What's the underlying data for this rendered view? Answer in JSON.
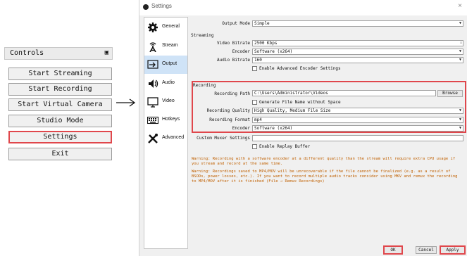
{
  "controls": {
    "title": "Controls",
    "buttons": [
      "Start Streaming",
      "Start Recording",
      "Start Virtual Camera",
      "Studio Mode",
      "Settings",
      "Exit"
    ],
    "highlighted": "Settings"
  },
  "window": {
    "title": "Settings",
    "close_label": "×"
  },
  "sidebar": {
    "items": [
      {
        "label": "General",
        "icon": "gear-icon"
      },
      {
        "label": "Stream",
        "icon": "stream-antenna-icon"
      },
      {
        "label": "Output",
        "icon": "output-icon"
      },
      {
        "label": "Audio",
        "icon": "speaker-icon"
      },
      {
        "label": "Video",
        "icon": "monitor-icon"
      },
      {
        "label": "Hotkeys",
        "icon": "keyboard-icon"
      },
      {
        "label": "Advanced",
        "icon": "tools-icon"
      }
    ],
    "active": "Output"
  },
  "output": {
    "output_mode_label": "Output Mode",
    "output_mode_value": "Simple",
    "streaming_heading": "Streaming",
    "video_bitrate_label": "Video Bitrate",
    "video_bitrate_value": "2500 Kbps",
    "stream_encoder_label": "Encoder",
    "stream_encoder_value": "Software (x264)",
    "audio_bitrate_label": "Audio Bitrate",
    "audio_bitrate_value": "160",
    "advanced_encoder_label": "Enable Advanced Encoder Settings",
    "recording_heading": "Recording",
    "recording_path_label": "Recording Path",
    "recording_path_value": "C:\\Users\\Administrator\\Videos",
    "browse_label": "Browse",
    "no_space_label": "Generate File Name without Space",
    "recording_quality_label": "Recording Quality",
    "recording_quality_value": "High Quality, Medium File Size",
    "recording_format_label": "Recording Format",
    "recording_format_value": "mp4",
    "rec_encoder_label": "Encoder",
    "rec_encoder_value": "Software (x264)",
    "custom_muxer_label": "Custom Muxer Settings",
    "custom_muxer_value": "",
    "replay_buffer_label": "Enable Replay Buffer",
    "warning1": "Warning: Recording with a software encoder at a different quality than the stream will require extra CPU usage if you stream and record at the same time.",
    "warning2": "Warning: Recordings saved to MP4/MOV will be unrecoverable if the file cannot be finalized (e.g. as a result of BSODs, power losses, etc.). If you want to record multiple audio tracks consider using MKV and remux the recording to MP4/MOV after it is finished (File → Remux Recordings)"
  },
  "footer": {
    "ok": "OK",
    "cancel": "Cancel",
    "apply": "Apply"
  },
  "colors": {
    "highlight": "#e0474c",
    "warning": "#c06000",
    "active_nav": "#cfe3f7"
  }
}
